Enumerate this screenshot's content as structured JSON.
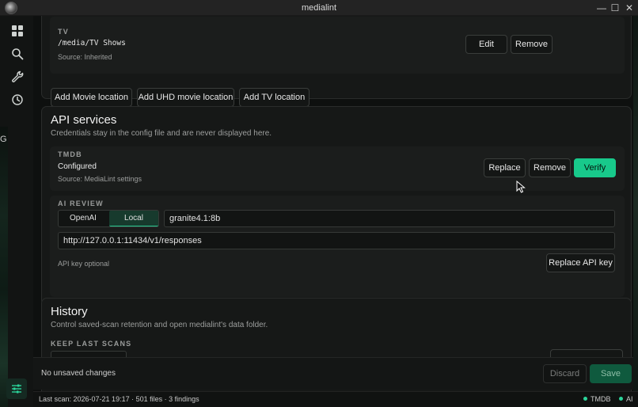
{
  "window": {
    "title": "medialint",
    "minimize": "—",
    "maximize": "☐",
    "close": "✕"
  },
  "rail": {
    "items": [
      {
        "name": "dashboard-icon"
      },
      {
        "name": "search-icon"
      },
      {
        "name": "wrench-icon"
      },
      {
        "name": "clock-icon"
      },
      {
        "name": "sliders-icon"
      }
    ],
    "edge_glyph": "G"
  },
  "locations": {
    "tv": {
      "eyebrow": "TV",
      "path": "/media/TV Shows",
      "source": "Source: Inherited",
      "edit_label": "Edit",
      "remove_label": "Remove"
    },
    "add_movie_label": "Add Movie location",
    "add_uhd_label": "Add UHD movie location",
    "add_tv_label": "Add TV location"
  },
  "api": {
    "title": "API services",
    "subtitle": "Credentials stay in the config file and are never displayed here.",
    "tmdb": {
      "eyebrow": "TMDB",
      "status": "Configured",
      "source": "Source: MediaLint settings",
      "replace_label": "Replace",
      "remove_label": "Remove",
      "verify_label": "Verify"
    },
    "ai": {
      "eyebrow": "AI REVIEW",
      "providers": [
        "OpenAI",
        "Local"
      ],
      "active_provider": "Local",
      "model": "granite4.1:8b",
      "endpoint": "http://127.0.0.1:11434/v1/responses",
      "key_note": "API key optional",
      "replace_key_label": "Replace API key"
    }
  },
  "history": {
    "title": "History",
    "subtitle": "Control saved-scan retention and open medialint's data folder.",
    "eyebrow": "KEEP LAST SCANS"
  },
  "footer": {
    "status": "No unsaved changes",
    "discard_label": "Discard",
    "save_label": "Save"
  },
  "statusbar": {
    "last_scan": "Last scan: 2026-07-21 19:17 · 501 files · 3 findings",
    "tmdb": "TMDB",
    "ai": "AI"
  },
  "colors": {
    "accent": "#18c98b",
    "background": "#0e100f",
    "card": "#161817"
  }
}
